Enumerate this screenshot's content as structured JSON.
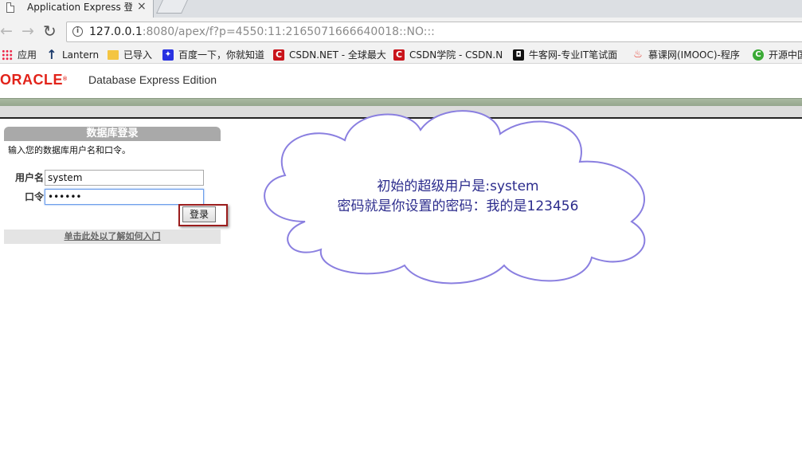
{
  "browser": {
    "tab": {
      "title": "Application Express 登录",
      "close": "×"
    },
    "address_host": "127.0.0.1",
    "address_rest": ":8080/apex/f?p=4550:11:2165071666640018::NO:::",
    "bookmarks": [
      {
        "label": "应用",
        "icon": "apps-grid-icon"
      },
      {
        "label": "Lantern",
        "icon": "lantern-icon"
      },
      {
        "label": "已导入",
        "icon": "folder-icon"
      },
      {
        "label": "百度一下，你就知道",
        "icon": "baidu-icon"
      },
      {
        "label": "CSDN.NET - 全球最大",
        "icon": "csdn-icon"
      },
      {
        "label": "CSDN学院 - CSDN.N",
        "icon": "csdn-icon"
      },
      {
        "label": "牛客网-专业IT笔试面",
        "icon": "nowcoder-icon"
      },
      {
        "label": "慕课网(IMOOC)-程序",
        "icon": "imooc-icon"
      },
      {
        "label": "开源中国",
        "icon": "oschina-icon"
      }
    ]
  },
  "header": {
    "logo_text": "ORACLE",
    "product_name": "Database Express Edition"
  },
  "login": {
    "title": "数据库登录",
    "instruction": "输入您的数据库用户名和口令。",
    "username_label": "用户名",
    "username_value": "system",
    "password_label": "口令",
    "password_value": "123456",
    "submit_label": "登录",
    "help_link": "单击此处以了解如何入门"
  },
  "annotation": {
    "line1": "初始的超级用户是:system",
    "line2": "密码就是你设置的密码：我的是123456"
  },
  "colors": {
    "oracle_red": "#e2231a",
    "header_band": "#a8b8a0",
    "annotation_stroke": "#8a7fe0",
    "highlight_border": "#9b1c1c"
  }
}
